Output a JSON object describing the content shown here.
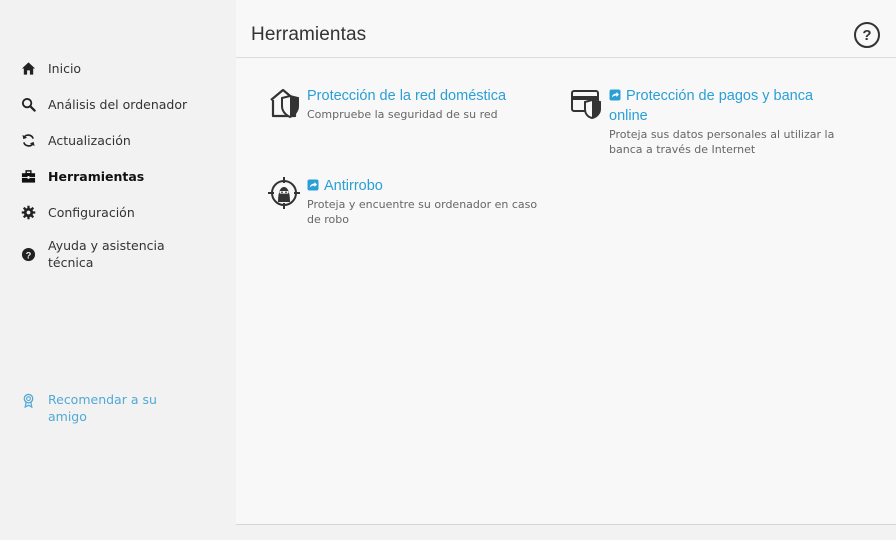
{
  "sidebar": {
    "items": [
      {
        "label": "Inicio",
        "icon": "home-icon"
      },
      {
        "label": "Análisis del ordenador",
        "icon": "search-icon"
      },
      {
        "label": "Actualización",
        "icon": "refresh-icon"
      },
      {
        "label": "Herramientas",
        "icon": "briefcase-icon",
        "active": true
      },
      {
        "label": "Configuración",
        "icon": "gear-icon"
      },
      {
        "label": "Ayuda y asistencia técnica",
        "icon": "help-icon"
      }
    ],
    "recommend_label": "Recomendar a su amigo"
  },
  "header": {
    "title": "Herramientas",
    "help_label": "?"
  },
  "tools": [
    {
      "title": "Protección de la red doméstica",
      "desc": "Compruebe la seguridad de su red",
      "icon": "home-shield-icon",
      "external": false
    },
    {
      "title": "Protección de pagos y banca online",
      "desc": "Proteja sus datos personales al utilizar la banca a través de Internet",
      "icon": "card-shield-icon",
      "external": true
    },
    {
      "title": "Antirrobo",
      "desc": "Proteja y encuentre su ordenador en caso de robo",
      "icon": "target-thief-icon",
      "external": true
    }
  ],
  "colors": {
    "accent": "#2a9fd6",
    "link": "#52a8d6",
    "brand": "#2bb3a3"
  }
}
